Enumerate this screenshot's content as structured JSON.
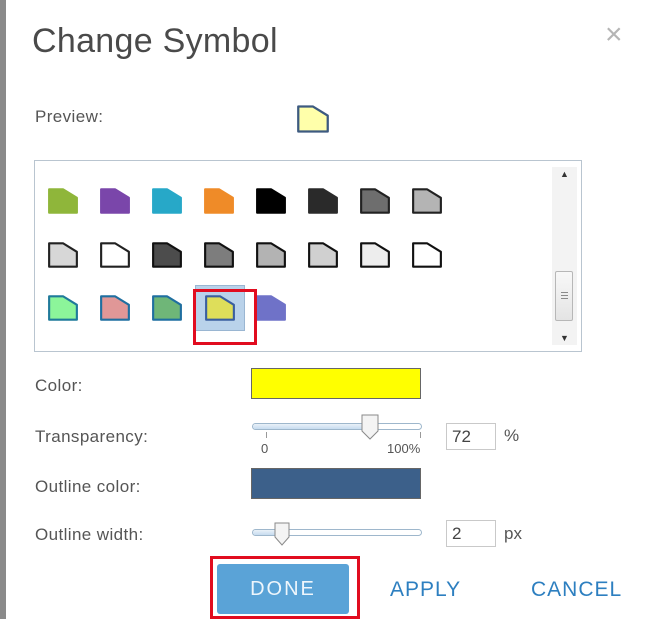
{
  "dialog": {
    "title": "Change Symbol",
    "close_label": "×"
  },
  "preview": {
    "label": "Preview:",
    "symbol_fill": "#ffffaa",
    "symbol_outline": "#3d5a80"
  },
  "gallery": {
    "rows": [
      [
        {
          "fill": "#8fb63a",
          "outline": "#8fb63a"
        },
        {
          "fill": "#7a46aa",
          "outline": "#7a46aa"
        },
        {
          "fill": "#27a8c8",
          "outline": "#27a8c8"
        },
        {
          "fill": "#ef8b28",
          "outline": "#ef8b28"
        },
        {
          "fill": "#000000",
          "outline": "#000000"
        },
        {
          "fill": "#2a2a2a",
          "outline": "#2a2a2a"
        },
        {
          "fill": "#6e6e6e",
          "outline": "#222222"
        },
        {
          "fill": "#b4b4b4",
          "outline": "#222222"
        }
      ],
      [
        {
          "fill": "#d7d7d7",
          "outline": "#222222"
        },
        {
          "fill": "#ffffff",
          "outline": "#222222"
        },
        {
          "fill": "#4c4c4c",
          "outline": "#111111"
        },
        {
          "fill": "#7d7d7d",
          "outline": "#111111"
        },
        {
          "fill": "#b3b3b3",
          "outline": "#111111"
        },
        {
          "fill": "#d0d0d0",
          "outline": "#111111"
        },
        {
          "fill": "#ededed",
          "outline": "#111111"
        },
        {
          "fill": "#ffffff",
          "outline": "#111111"
        }
      ],
      [
        {
          "fill": "#8cf59a",
          "outline": "#1f7a9a"
        },
        {
          "fill": "#e09797",
          "outline": "#1f6fa0"
        },
        {
          "fill": "#6fb678",
          "outline": "#1f6fa0"
        },
        {
          "fill": "#dede5a",
          "outline": "#3a5f9f",
          "selected": true
        },
        {
          "fill": "#6f72c8",
          "outline": "#6f72c8"
        }
      ]
    ]
  },
  "color": {
    "label": "Color:",
    "value": "#ffff00"
  },
  "transparency": {
    "label": "Transparency:",
    "value": 72,
    "value_text": "72",
    "unit": "%",
    "min_label": "0",
    "max_label": "100%"
  },
  "outline_color": {
    "label": "Outline color:",
    "value": "#3c608a"
  },
  "outline_width": {
    "label": "Outline width:",
    "value_text": "2",
    "unit": "px",
    "level": 0.18
  },
  "buttons": {
    "done": "DONE",
    "apply": "APPLY",
    "cancel": "CANCEL"
  }
}
